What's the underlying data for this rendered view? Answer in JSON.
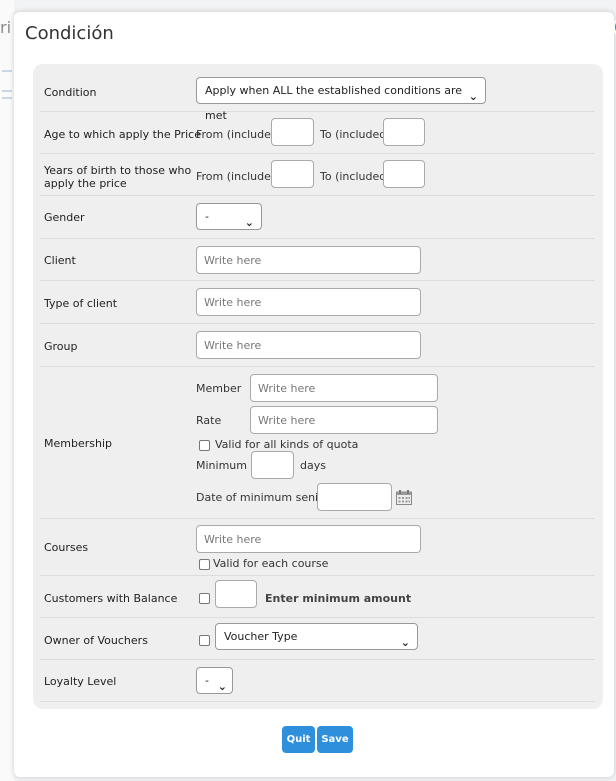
{
  "background": {
    "fragment": "ri"
  },
  "dialog": {
    "title": "Condición",
    "close_glyph": "✕",
    "quit_label": "Quit",
    "save_label": "Save"
  },
  "labels": {
    "condition": "Condition",
    "age": "Age to which apply the Price",
    "years_birth": "Years of birth to those who apply the price",
    "gender": "Gender",
    "client": "Client",
    "type_client": "Type of client",
    "group": "Group",
    "membership": "Membership",
    "courses": "Courses",
    "customers_balance": "Customers with Balance",
    "owner_vouchers": "Owner of Vouchers",
    "loyalty": "Loyalty Level"
  },
  "condition": {
    "selected": "Apply when ALL the established conditions are met"
  },
  "range": {
    "from": "From (included):",
    "to": "To (included):"
  },
  "gender": {
    "selected": "-"
  },
  "placeholder": "Write here",
  "membership": {
    "member": "Member",
    "rate": "Rate",
    "valid_all": "Valid for all kinds of quota",
    "minimum_of": "Minimum of",
    "days": "days",
    "seniority": "Date of minimum seniority"
  },
  "courses": {
    "valid_each": "Valid for each course"
  },
  "balance": {
    "hint": "Enter minimum amount"
  },
  "vouchers": {
    "selected": "Voucher Type"
  },
  "loyalty": {
    "selected": "-"
  },
  "icons": {
    "close": "close-icon",
    "calendar": "calendar-icon",
    "chevron": "chevron-down-icon"
  }
}
